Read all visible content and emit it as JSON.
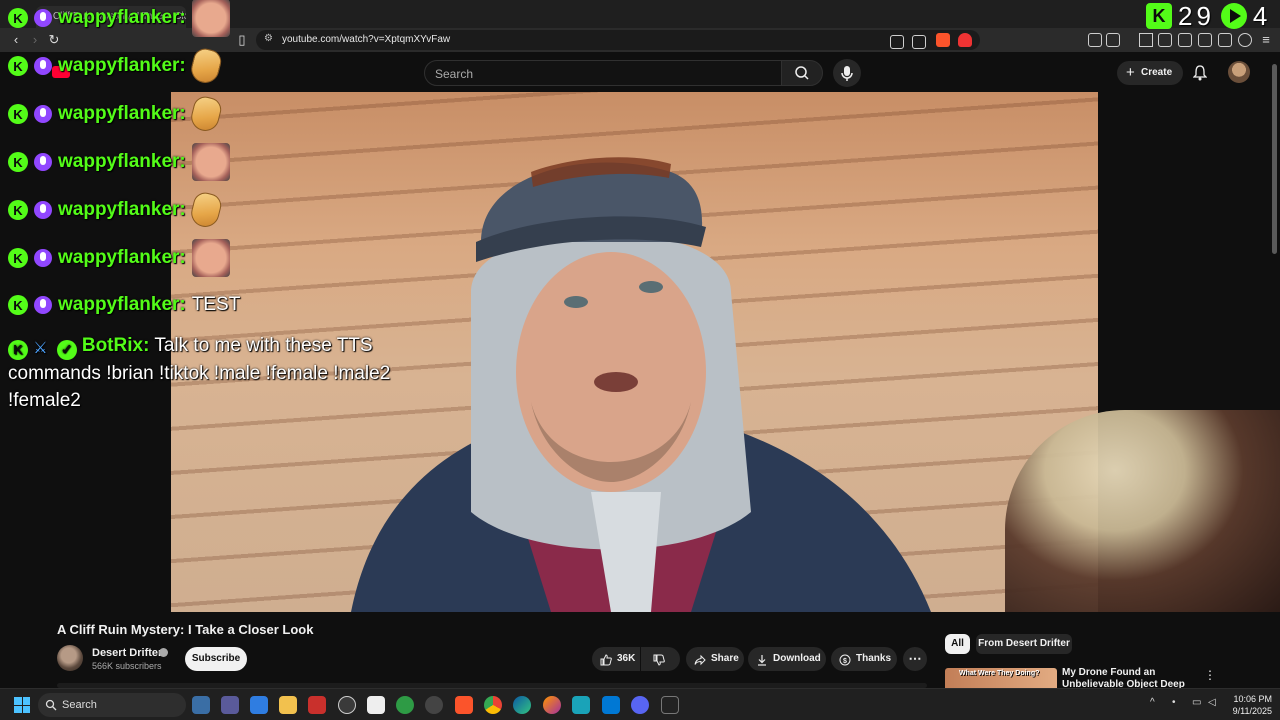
{
  "browser": {
    "tab_title": "A Cliff Ruin Mystery: I Take a Closer Look",
    "url": "youtube.com/watch?v=XptqmXYvFaw"
  },
  "youtube": {
    "search_placeholder": "Search",
    "create_label": "Create"
  },
  "chat": {
    "username": "wappyflanker:",
    "test_message": "TEST",
    "bot_name": "BotRix:",
    "bot_message": "Talk to me with these TTS commands !brian !tiktok !male !female !male2 !female2"
  },
  "counter": {
    "viewers": "29",
    "second": "4"
  },
  "video": {
    "title": "A Cliff Ruin Mystery: I Take a Closer Look",
    "channel_name": "Desert Drifter",
    "subscribers": "566K subscribers",
    "subscribe_label": "Subscribe",
    "likes": "36K",
    "share_label": "Share",
    "download_label": "Download",
    "thanks_label": "Thanks"
  },
  "recommendations": {
    "chip_all": "All",
    "chip_from": "From Desert Drifter",
    "first_thumb_text": "What Were They Doing?",
    "first_title": "My Drone Found an Unbelievable Object Deep in the"
  },
  "taskbar": {
    "search_label": "Search",
    "time": "10:06 PM",
    "date": "9/11/2025"
  },
  "colors": {
    "kick_green": "#53fc18",
    "yt_bg": "#0f0f0f",
    "mic_purple": "#9147ff"
  }
}
